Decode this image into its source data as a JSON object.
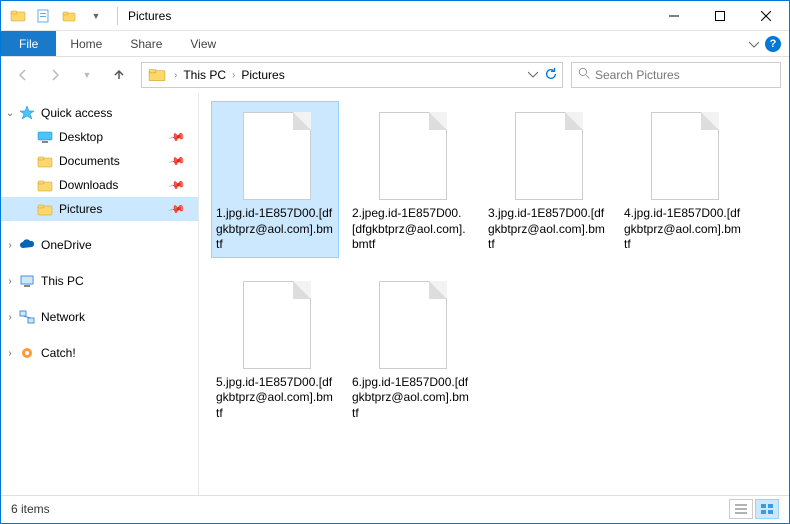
{
  "window": {
    "title": "Pictures"
  },
  "ribbon": {
    "file": "File",
    "tabs": [
      "Home",
      "Share",
      "View"
    ]
  },
  "nav": {
    "breadcrumb": [
      "This PC",
      "Pictures"
    ],
    "search_placeholder": "Search Pictures"
  },
  "sidebar": {
    "quick_access": {
      "label": "Quick access",
      "items": [
        {
          "label": "Desktop",
          "pinned": true,
          "icon": "desktop"
        },
        {
          "label": "Documents",
          "pinned": true,
          "icon": "folder"
        },
        {
          "label": "Downloads",
          "pinned": true,
          "icon": "folder"
        },
        {
          "label": "Pictures",
          "pinned": true,
          "icon": "folder",
          "selected": true
        }
      ]
    },
    "roots": [
      {
        "label": "OneDrive",
        "icon": "onedrive"
      },
      {
        "label": "This PC",
        "icon": "thispc"
      },
      {
        "label": "Network",
        "icon": "network"
      },
      {
        "label": "Catch!",
        "icon": "catch"
      }
    ]
  },
  "files": [
    {
      "name": "1.jpg.id-1E857D00.[dfgkbtprz@aol.com].bmtf",
      "selected": true
    },
    {
      "name": "2.jpeg.id-1E857D00.[dfgkbtprz@aol.com].bmtf",
      "selected": false
    },
    {
      "name": "3.jpg.id-1E857D00.[dfgkbtprz@aol.com].bmtf",
      "selected": false
    },
    {
      "name": "4.jpg.id-1E857D00.[dfgkbtprz@aol.com].bmtf",
      "selected": false
    },
    {
      "name": "5.jpg.id-1E857D00.[dfgkbtprz@aol.com].bmtf",
      "selected": false
    },
    {
      "name": "6.jpg.id-1E857D00.[dfgkbtprz@aol.com].bmtf",
      "selected": false
    }
  ],
  "status": {
    "count_text": "6 items"
  }
}
